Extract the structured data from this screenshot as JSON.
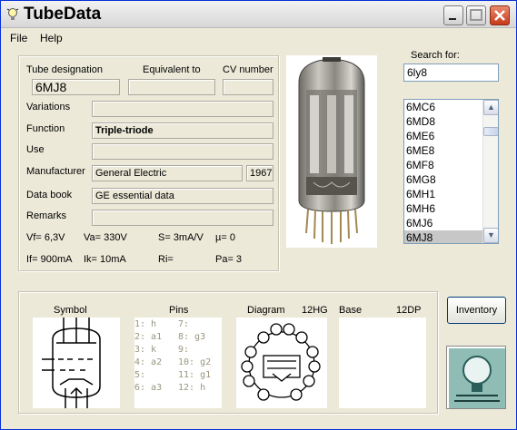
{
  "app": {
    "title": "TubeData"
  },
  "menu": {
    "file": "File",
    "help": "Help"
  },
  "details": {
    "tube_designation_label": "Tube designation",
    "equivalent_label": "Equivalent to",
    "cv_label": "CV number",
    "tube_designation": "6MJ8",
    "equivalent": "",
    "cv_number": "",
    "variations_label": "Variations",
    "variations": "",
    "function_label": "Function",
    "function": "Triple-triode",
    "use_label": "Use",
    "use": "",
    "manufacturer_label": "Manufacturer",
    "manufacturer": "General Electric",
    "year": "1967",
    "databook_label": "Data book",
    "databook": "GE essential data",
    "remarks_label": "Remarks",
    "remarks": ""
  },
  "specs": {
    "vf": "Vf= 6,3V",
    "va": "Va= 330V",
    "s": "S= 3mA/V",
    "mu": "µ=   0",
    "if": "If= 900mA",
    "ik": "Ik=  10mA",
    "ri": "Ri=",
    "pa": "Pa= 3"
  },
  "search": {
    "label": "Search for:",
    "value": "6ly8"
  },
  "tube_list": [
    "6MC6",
    "6MD8",
    "6ME6",
    "6ME8",
    "6MF8",
    "6MG8",
    "6MH1",
    "6MH6",
    "6MJ6",
    "6MJ8"
  ],
  "bottom": {
    "symbol_label": "Symbol",
    "pins_label": "Pins",
    "diagram_label": "Diagram",
    "diagram_code": "12HG",
    "base_label": "Base",
    "base_code": "12DP",
    "pins_left": [
      "1: h",
      "2: a1",
      "3: k",
      "4: a2",
      "5:",
      "6: a3"
    ],
    "pins_right": [
      "7:",
      "8: g3",
      "9:",
      "10: g2",
      "11: g1",
      "12: h"
    ]
  },
  "inventory_button": "Inventory",
  "colors": {
    "title_bar": "#e6e6e6",
    "window_bg": "#ece9d8",
    "list_selected": "#c7c7c7",
    "close_button": "#c8391a"
  }
}
